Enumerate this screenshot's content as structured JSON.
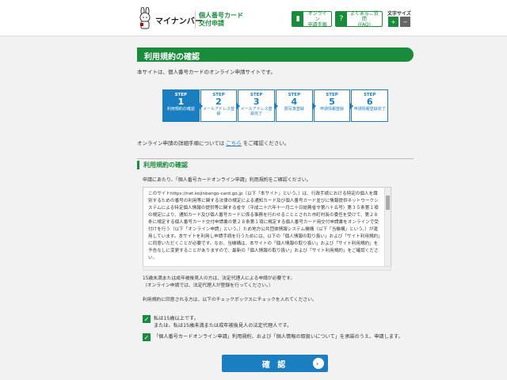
{
  "header": {
    "logo_text": "マイナンバー",
    "site_title_line1": "個人番号カード",
    "site_title_line2": "交付申請",
    "guide_btn_line1": "オンライン",
    "guide_btn_line2": "申請手順",
    "faq_btn_line1": "よくあるご質問",
    "faq_btn_line2": "(FAQ)",
    "font_size_label": "文字サイズ",
    "font_plus": "+",
    "font_minus": "−"
  },
  "page": {
    "title": "利用規約の確認",
    "intro": "本サイトは、個人番号カードのオンライン申請サイトです。",
    "online_guide_prefix": "オンライン申請の詳細手順については",
    "online_guide_link": "こちら",
    "online_guide_suffix": "をご確認ください。"
  },
  "steps": [
    {
      "label": "STEP",
      "num": "1",
      "desc": "利用規約の確認"
    },
    {
      "label": "STEP",
      "num": "2",
      "desc": "メールアドレス登録"
    },
    {
      "label": "STEP",
      "num": "3",
      "desc": "メールアドレス登録完了"
    },
    {
      "label": "STEP",
      "num": "4",
      "desc": "顔写真登録"
    },
    {
      "label": "STEP",
      "num": "5",
      "desc": "申請情報登録"
    },
    {
      "label": "STEP",
      "num": "6",
      "desc": "申請情報登録完了"
    }
  ],
  "terms": {
    "heading": "利用規約の確認",
    "note": "申請にあたり、「個人番号カードオンライン申請」利用規約をご確認ください。",
    "body": "このサイトhttps://net.kojinbango-card.go.jp（以下「本サイト」という。）は、行政手続における特定の個人を識別するための番号の利用等に関する法律の規定による通知カード及び個人番号カード並びに情報提供ネットワークシステムによる特定個人情報の提供等に関する省令（平成二十六年十一月二十日総務省令第八十五号）第３５条第１項の規定により、通知カード及び個人番号カードに係る事務を行わせることとされた市町村長の委任を受けて、第２８条に規定する個人番号カード交付申請書の第２８条第１項に規定する個人番号カード用交付申請書をオンラインで受付けを行う（以下「オンライン申請」という。）ため地方公共団体情報システム機構（以下「当機構」という。）が運用しています。本サイトを利用し申請手続を行うためには、以下の「個人情報の取り扱い」および「サイト利用規約」に同意いただくことが必要です。なお、当機構は、本サイトの「個人情報の取り扱い」および「サイト利用規約」を予告なしに変更することがありますので、最新の「個人情報の取り扱い」および「サイト利用規約」をご確認ください。"
  },
  "notes": {
    "line1": "15歳未満または成年被後見人の方は、法定代理人による申請が必要です。",
    "line2": "（オンライン申請では、法定代理人が登録を行ってください。）",
    "line3": "利用規約に同意される方は、以下のチェックボックスにチェックを入れてください。"
  },
  "checks": {
    "check1_line1": "私は15歳以上です。",
    "check1_line2": "または、私は15歳未満または成年被後見人の法定代理人です。",
    "check2": "「個人番号カードオンライン申請」利用規約、および「個人情報の取扱いについて」を承諾のうえ、申請します。",
    "checkmark": "✓"
  },
  "confirm": {
    "label": "確 認",
    "arrow": "›"
  }
}
